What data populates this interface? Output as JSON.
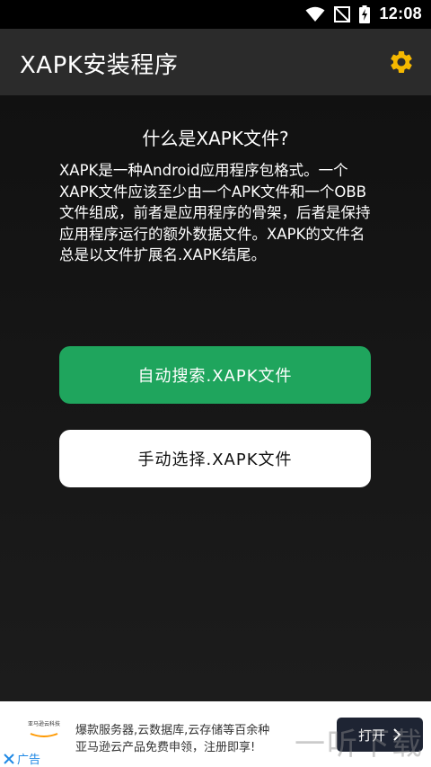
{
  "status_bar": {
    "time": "12:08",
    "icons": [
      "wifi-icon",
      "no-signal-icon",
      "battery-charging-icon"
    ]
  },
  "app_bar": {
    "title": "XAPK安装程序",
    "settings_icon": "gear-icon",
    "accent": "#f5b800"
  },
  "content": {
    "heading": "什么是XAPK文件?",
    "description": "XAPK是一种Android应用程序包格式。一个XAPK文件应该至少由一个APK文件和一个OBB文件组成，前者是应用程序的骨架，后者是保持应用程序运行的额外数据文件。XAPK的文件名总是以文件扩展名.XAPK结尾。",
    "auto_button": "自动搜索.XAPK文件",
    "manual_button": "手动选择.XAPK文件",
    "auto_color": "#1fa55d"
  },
  "ad": {
    "logo_text": "亚马逊云科技",
    "line1": "爆款服务器,云数据库,云存储等百余种",
    "line2": "亚马逊云产品免费申领，注册即享!",
    "open_button": "打开",
    "tag": "广告"
  },
  "watermark": "一听下载"
}
